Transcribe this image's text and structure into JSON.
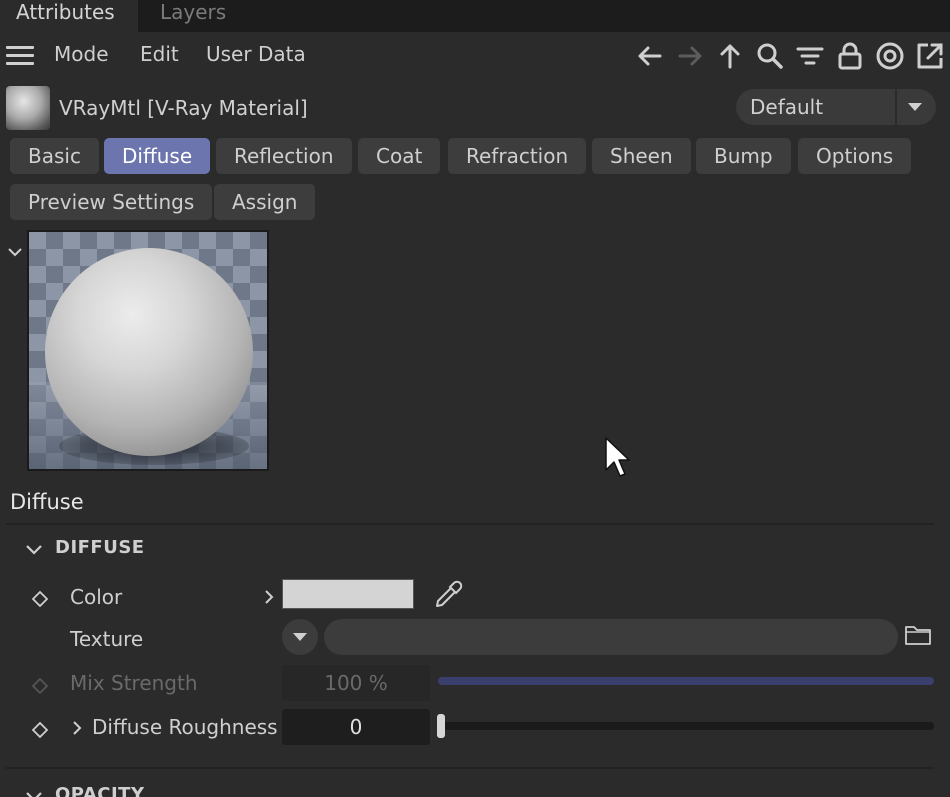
{
  "tabs": {
    "attributes": "Attributes",
    "layers": "Layers"
  },
  "menu": {
    "mode": "Mode",
    "edit": "Edit",
    "user_data": "User Data"
  },
  "toolbar_icons": [
    "arrow-left-icon",
    "arrow-right-icon",
    "arrow-up-icon",
    "search-icon",
    "filter-icon",
    "lock-icon",
    "target-icon",
    "external-window-icon"
  ],
  "header": {
    "material_title": "VRayMtl [V-Ray Material]",
    "preset": "Default"
  },
  "material_tabs": {
    "basic": "Basic",
    "diffuse": "Diffuse",
    "reflection": "Reflection",
    "coat": "Coat",
    "refraction": "Refraction",
    "sheen": "Sheen",
    "bump": "Bump",
    "options": "Options",
    "preview_settings": "Preview Settings",
    "assign": "Assign"
  },
  "active_tab": "Diffuse",
  "section": {
    "title": "Diffuse"
  },
  "groups": {
    "diffuse": "DIFFUSE",
    "opacity": "OPACITY"
  },
  "properties": {
    "color": {
      "label": "Color",
      "value": "#d4d4d4"
    },
    "texture": {
      "label": "Texture",
      "value": ""
    },
    "mix_strength": {
      "label": "Mix Strength",
      "value": "100 %",
      "level": 1.0
    },
    "diffuse_roughness": {
      "label": "Diffuse Roughness",
      "value": "0",
      "level": 0.0
    }
  },
  "colors": {
    "accent": "#6c75ae",
    "background": "#2b2b2b",
    "tabbar": "#1c1c1c",
    "slider_fill": "#3a3f6e"
  }
}
